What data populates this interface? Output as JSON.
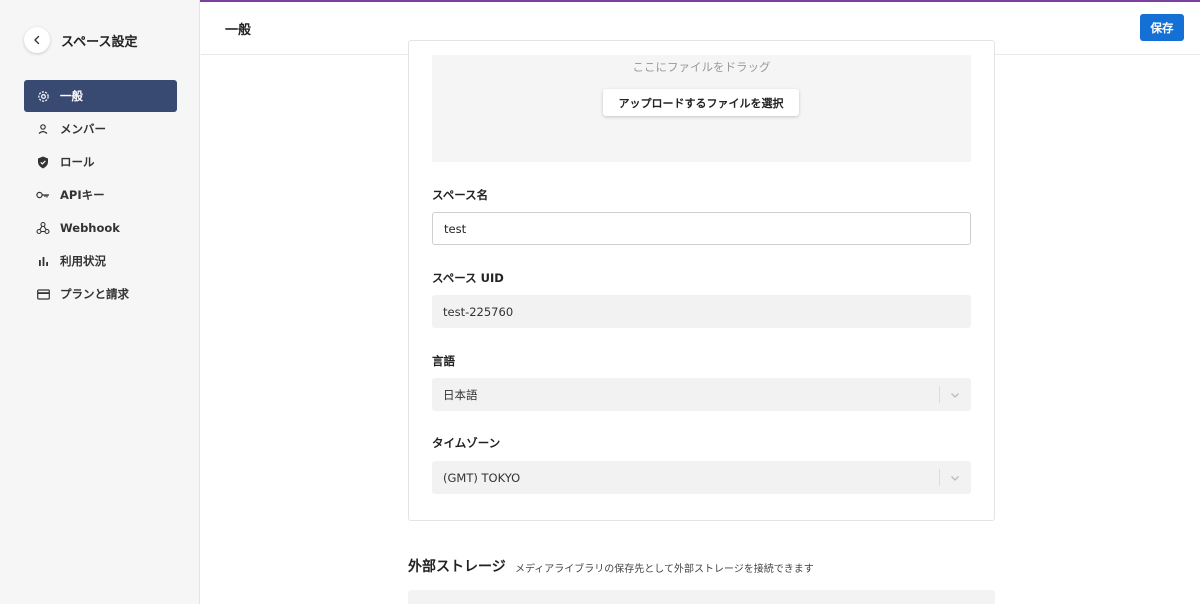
{
  "sidebar": {
    "title": "スペース設定",
    "items": [
      {
        "label": "一般",
        "icon": "gear-icon",
        "active": true
      },
      {
        "label": "メンバー",
        "icon": "person-icon",
        "active": false
      },
      {
        "label": "ロール",
        "icon": "shield-icon",
        "active": false
      },
      {
        "label": "APIキー",
        "icon": "key-icon",
        "active": false
      },
      {
        "label": "Webhook",
        "icon": "webhook-icon",
        "active": false
      },
      {
        "label": "利用状況",
        "icon": "bar-chart-icon",
        "active": false
      },
      {
        "label": "プランと請求",
        "icon": "credit-card-icon",
        "active": false
      }
    ]
  },
  "header": {
    "title": "一般",
    "save_label": "保存"
  },
  "upload": {
    "hint": "ここにファイルをドラッグ",
    "button_label": "アップロードするファイルを選択"
  },
  "form": {
    "space_name": {
      "label": "スペース名",
      "value": "test"
    },
    "space_uid": {
      "label": "スペース UID",
      "value": "test-225760"
    },
    "language": {
      "label": "言語",
      "value": "日本語"
    },
    "timezone": {
      "label": "タイムゾーン",
      "value": "(GMT) TOKYO"
    }
  },
  "external_storage": {
    "title": "外部ストレージ",
    "description": "メディアライブラリの保存先として外部ストレージを接続できます"
  },
  "colors": {
    "accent": "#1570d6",
    "active_nav": "#394a72",
    "top_line": "#7b3fa0"
  }
}
